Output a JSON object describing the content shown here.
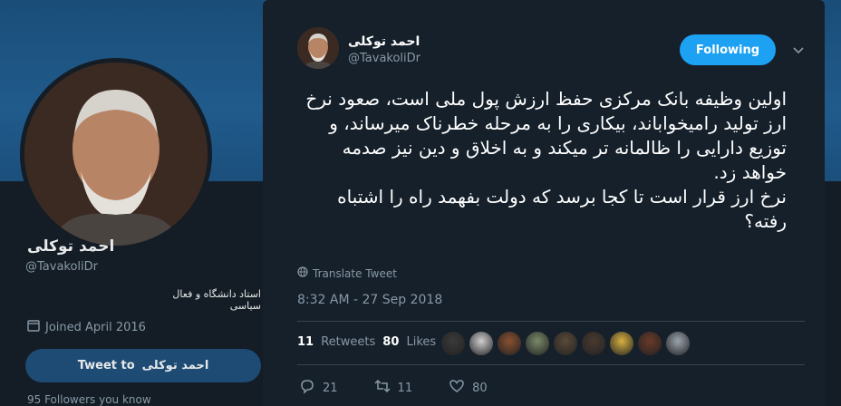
{
  "profile": {
    "name": "احمد توکلی",
    "handle": "@TavakoliDr",
    "bio": "استاد دانشگاه و فعال سیاسی",
    "joined": "Joined April 2016",
    "tweet_to_label": "Tweet to",
    "tweet_to_name": "احمد توکلی",
    "followers_line": "95 Followers you know"
  },
  "tweet": {
    "author_name": "احمد توکلی",
    "author_handle": "@TavakoliDr",
    "follow_label": "Following",
    "text": "اولین وظیفه بانک مرکزی حفظ ارزش پول ملی است، صعود نرخ ارز تولید رامیخواباند، بیکاری را به مرحله خطرناک میرساند، و توزیع دارایی را ظالمانه تر میکند و به اخلاق و دین نیز صدمه خواهد زد.\nنرخ ارز قرار است تا کجا برسد که دولت بفهمد راه را اشتباه رفته؟",
    "translate_label": "Translate Tweet",
    "timestamp": "8:32 AM - 27 Sep 2018",
    "retweets_count": "11",
    "retweets_label": "Retweets",
    "likes_count": "80",
    "likes_label": "Likes",
    "reply_count": "21",
    "retweet_action_count": "11",
    "like_action_count": "80"
  },
  "icons": {
    "caret": "chevron-down-icon",
    "globe": "globe-icon",
    "calendar": "calendar-icon",
    "reply": "reply-icon",
    "retweet": "retweet-icon",
    "like": "heart-icon"
  },
  "colors": {
    "accent": "#1da1f2",
    "modal_bg": "#15202b",
    "muted": "#8899a6"
  },
  "liker_colors": [
    "#3a3a3a",
    "#cfcfcf",
    "#8a5030",
    "#7a8a6a",
    "#5a4a3a",
    "#4a3a30",
    "#d8b040",
    "#6a3a2a",
    "#9aa4ae"
  ]
}
